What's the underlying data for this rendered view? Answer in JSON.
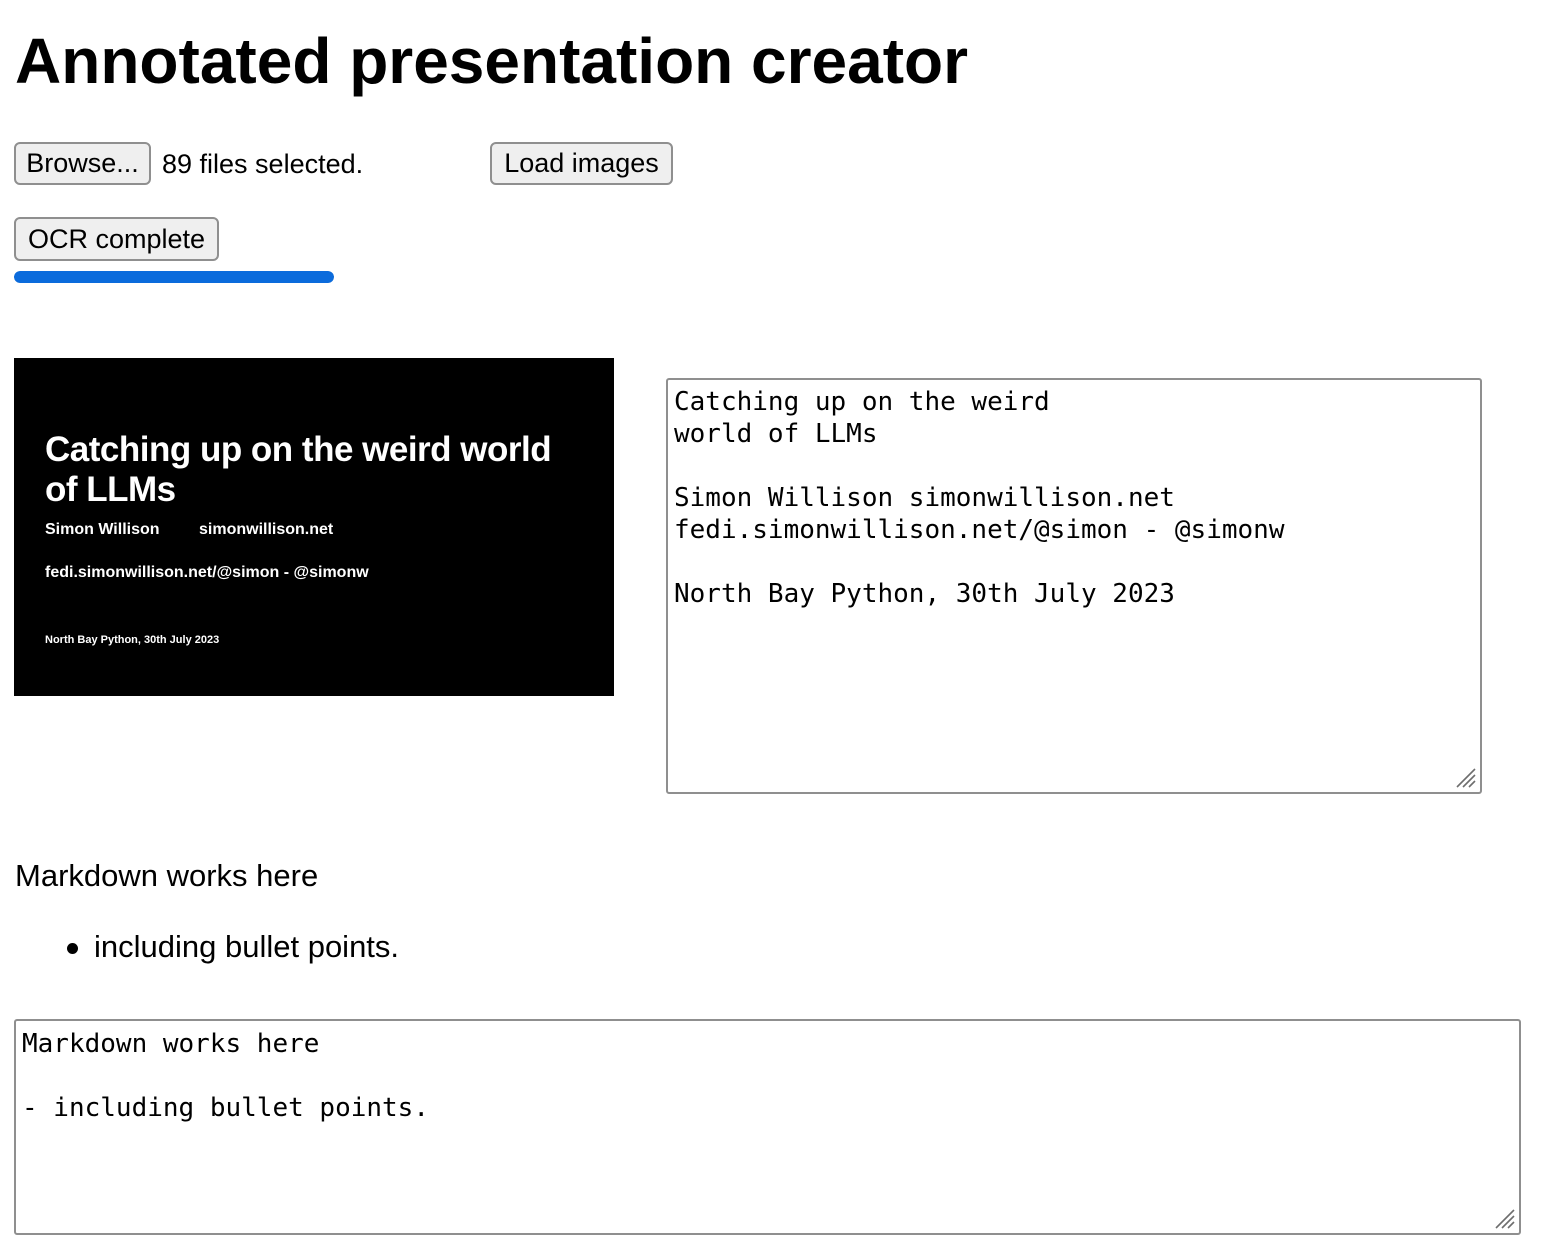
{
  "page": {
    "title": "Annotated presentation creator"
  },
  "file_picker": {
    "browse_label": "Browse...",
    "status": "89 files selected."
  },
  "load_images": {
    "label": "Load images"
  },
  "ocr": {
    "button_label": "OCR complete",
    "progress": 1.0,
    "progress_color": "#0b6bdc"
  },
  "slide": {
    "title": "Catching up on the weird world of LLMs",
    "name": "Simon Willison",
    "site": "simonwillison.net",
    "fedi": "fedi.simonwillison.net/@simon - @simonw",
    "event": "North Bay Python, 30th July 2023",
    "background_color": "#000000",
    "text_color": "#ffffff"
  },
  "ocr_text": {
    "value": "Catching up on the weird\nworld of LLMs\n\nSimon Willison simonwillison.net\nfedi.simonwillison.net/@simon - @simonw\n\nNorth Bay Python, 30th July 2023"
  },
  "rendered_markdown": {
    "paragraph": "Markdown works here",
    "list_items": [
      "including bullet points."
    ]
  },
  "notes": {
    "value": "Markdown works here\n\n- including bullet points."
  }
}
